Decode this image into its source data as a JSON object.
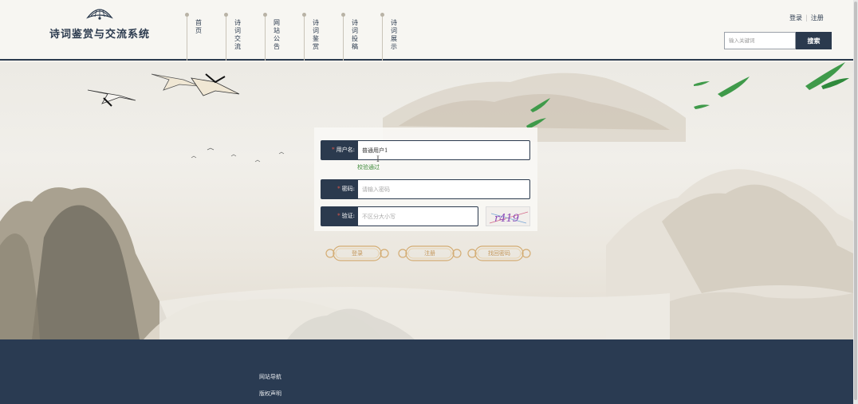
{
  "header": {
    "site_title": "诗词鉴赏与交流系统",
    "nav": [
      {
        "label": "首页"
      },
      {
        "label": "诗词交流"
      },
      {
        "label": "网站公告"
      },
      {
        "label": "诗词鉴赏"
      },
      {
        "label": "诗词投稿"
      },
      {
        "label": "诗词展示"
      }
    ],
    "login_link": "登录",
    "register_link": "注册",
    "search_placeholder": "输入关键词",
    "search_button": "搜索"
  },
  "login_form": {
    "username_label": "用户名:",
    "username_value": "普通用户1",
    "username_hint": "校验通过",
    "password_label": "密码:",
    "password_placeholder": "请输入密码",
    "captcha_label": "验证:",
    "captcha_placeholder": "不区分大小写",
    "captcha_text": "r419",
    "login_button": "登录",
    "register_button": "注册",
    "forgot_button": "找回密码"
  },
  "footer": {
    "links": [
      "网站导航",
      "版权声明"
    ]
  },
  "colors": {
    "primary": "#2b3a4e",
    "footer_bg": "#2a3b52",
    "hint_green": "#3f8a3a",
    "required_star": "#e0584a",
    "button_gold": "#c3965a"
  }
}
